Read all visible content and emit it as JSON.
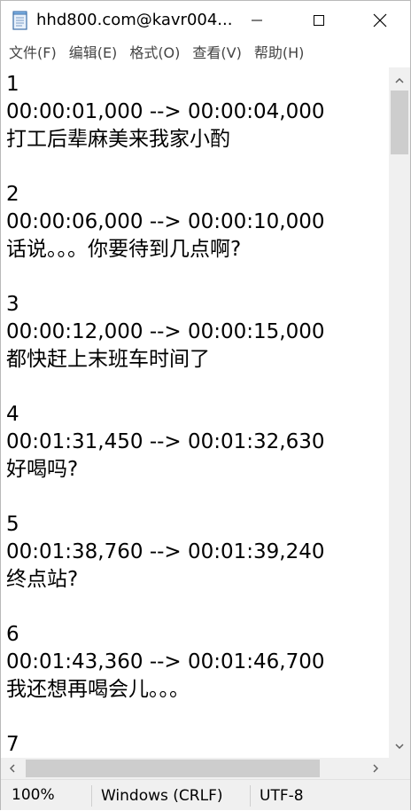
{
  "window": {
    "title": "hhd800.com@kavr004...",
    "controls": {
      "minimize": "minimize",
      "maximize": "maximize",
      "close": "close"
    }
  },
  "menu": [
    {
      "label": "文件(F)"
    },
    {
      "label": "编辑(E)"
    },
    {
      "label": "格式(O)"
    },
    {
      "label": "查看(V)"
    },
    {
      "label": "帮助(H)"
    }
  ],
  "editor": {
    "lines": [
      "1",
      "00:00:01,000 --> 00:00:04,000",
      "打工后辈麻美来我家小酌",
      "",
      "2",
      "00:00:06,000 --> 00:00:10,000",
      "话说。。。你要待到几点啊?",
      "",
      "3",
      "00:00:12,000 --> 00:00:15,000",
      "都快赶上末班车时间了",
      "",
      "4",
      "00:01:31,450 --> 00:01:32,630",
      "好喝吗?",
      "",
      "5",
      "00:01:38,760 --> 00:01:39,240",
      "终点站?",
      "",
      "6",
      "00:01:43,360 --> 00:01:46,700",
      "我还想再喝会儿。。。",
      "",
      "7"
    ]
  },
  "status": {
    "zoom": "100%",
    "line_ending": "Windows (CRLF)",
    "encoding": "UTF-8"
  },
  "colors": {
    "chrome": "#f0f0f0",
    "scroll_thumb": "#cdcdcd",
    "text": "#000000",
    "menu_text": "#444444"
  }
}
